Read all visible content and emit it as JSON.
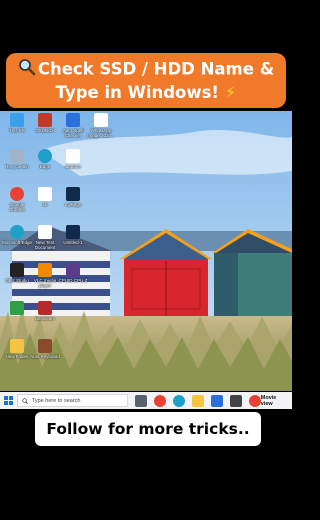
{
  "banner": {
    "line1": "Check SSD / HDD Name &",
    "line2": "Type in Windows!",
    "emoji_left": "magnifying-glass",
    "emoji_right": "high-voltage"
  },
  "desktop_icons": [
    {
      "label": "This PC",
      "icon": "pc-icon",
      "color": "#3aa0e8"
    },
    {
      "label": "CRUNCH",
      "icon": "app-icon",
      "color": "#c0392b"
    },
    {
      "label": "Auto Spell Checker",
      "icon": "check-icon",
      "color": "#2a6fdb"
    },
    {
      "label": "WhatsApp Image 2024...",
      "icon": "image-file-icon",
      "color": "#ffffff"
    },
    {
      "label": "Recycle Bin",
      "icon": "recycle-bin-icon",
      "color": "#9fb4c8"
    },
    {
      "label": "Edge",
      "icon": "edge-icon",
      "color": "#1fa0c8"
    },
    {
      "label": "Capture",
      "icon": "image-file-icon",
      "color": "#ffffff"
    },
    {
      "label": "Google Chrome",
      "icon": "chrome-icon",
      "color": "#e94235"
    },
    {
      "label": "sb",
      "icon": "image-file-icon",
      "color": "#ffffff"
    },
    {
      "label": "myBags",
      "icon": "photoshop-icon",
      "color": "#0f2a4a"
    },
    {
      "label": "Microsoft Edge",
      "icon": "edge-icon",
      "color": "#1fa0c8"
    },
    {
      "label": "New Text Document",
      "icon": "image-file-icon",
      "color": "#ffffff"
    },
    {
      "label": "Untitled-1",
      "icon": "photoshop-icon",
      "color": "#0f2a4a"
    },
    {
      "label": "OBS Studio",
      "icon": "obs-icon",
      "color": "#222222"
    },
    {
      "label": "VLC media player",
      "icon": "vlc-icon",
      "color": "#f08a00"
    },
    {
      "label": "CPUID CPU-Z",
      "icon": "cpu-icon",
      "color": "#5b3b8c"
    },
    {
      "label": "",
      "icon": "app-icon",
      "color": "#2f9e44"
    },
    {
      "label": "Bandicam",
      "icon": "camera-icon",
      "color": "#b32b2b"
    },
    {
      "label": "New Folder",
      "icon": "folder-icon",
      "color": "#f5c542"
    },
    {
      "label": "Auto Keyboard",
      "icon": "keyboard-icon",
      "color": "#8a4b2a"
    }
  ],
  "taskbar": {
    "search_placeholder": "Type here to search",
    "apps": [
      {
        "icon": "task-view-icon",
        "color": "#5a6270"
      },
      {
        "icon": "chrome-icon",
        "color": "#e94235"
      },
      {
        "icon": "edge-icon",
        "color": "#1fa0c8"
      },
      {
        "icon": "file-explorer-icon",
        "color": "#f5c542"
      },
      {
        "icon": "store-icon",
        "color": "#2a6fdb"
      },
      {
        "icon": "app-icon",
        "color": "#444444"
      },
      {
        "icon": "chrome-icon",
        "color": "#e94235"
      }
    ],
    "weather": "Movie view"
  },
  "follow": {
    "text": "Follow for more tricks.."
  }
}
